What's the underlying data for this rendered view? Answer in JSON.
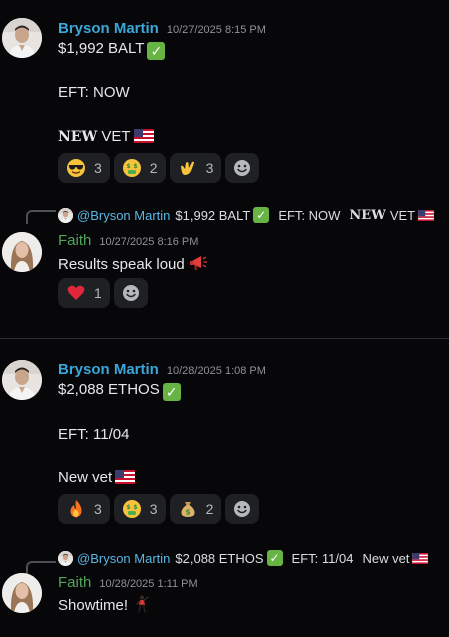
{
  "messages": [
    {
      "author": "Bryson Martin",
      "timestamp": "10/27/2025 8:15 PM",
      "lines": [
        "$1,992 BALT",
        "EFT: NOW",
        "NEW",
        "VET"
      ],
      "reactions": [
        {
          "emoji": "sunglasses-face",
          "count": "3"
        },
        {
          "emoji": "money-mouth-face",
          "count": "2"
        },
        {
          "emoji": "call-me-hand",
          "count": "3"
        }
      ]
    },
    {
      "author": "Faith",
      "timestamp": "10/27/2025 8:16 PM",
      "reply": {
        "mention": "@Bryson Martin",
        "amount": "$1,992 BALT",
        "eft": "EFT: NOW",
        "new": "NEW",
        "vet": "VET"
      },
      "text": "Results speak loud",
      "reactions": [
        {
          "emoji": "red-heart",
          "count": "1"
        }
      ]
    },
    {
      "author": "Bryson Martin",
      "timestamp": "10/28/2025 1:08 PM",
      "lines": [
        "$2,088 ETHOS",
        "EFT: 11/04",
        "New vet"
      ],
      "reactions": [
        {
          "emoji": "fire",
          "count": "3"
        },
        {
          "emoji": "money-mouth-face",
          "count": "3"
        },
        {
          "emoji": "money-bag",
          "count": "2"
        }
      ]
    },
    {
      "author": "Faith",
      "timestamp": "10/28/2025 1:11 PM",
      "reply": {
        "mention": "@Bryson Martin",
        "amount": "$2,088 ETHOS",
        "eft": "EFT: 11/04",
        "vet": "New vet"
      },
      "text": "Showtime!"
    }
  ],
  "colors": {
    "background": "#070709",
    "author_bryson": "#3ba6d8",
    "author_faith": "#52a55a",
    "mention": "#5ab5e3",
    "reaction_bg": "#1f2024"
  }
}
